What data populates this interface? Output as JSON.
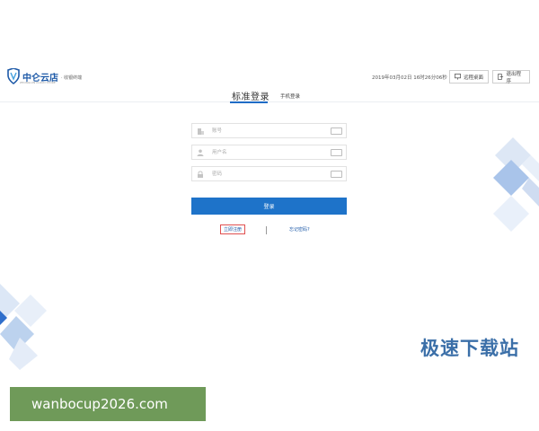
{
  "header": {
    "brand_name": "中仑云店",
    "brand_sub": "· 收银终端",
    "brand_en": "ZHONGLUN CLOUD STORE",
    "datetime": "2019年03月02日 16时26分06秒",
    "button_a": "远程桌面",
    "button_b": "退出程序"
  },
  "tabs": {
    "main": "标准登录",
    "sub": "手机登录"
  },
  "form": {
    "account_placeholder": "账号",
    "username_placeholder": "用户名",
    "password_placeholder": "密码",
    "login_label": "登录",
    "register_label": "立即注册",
    "forgot_label": "忘记密码?"
  },
  "watermark": {
    "text": "极速下载站",
    "url": "wanbocup2026.com"
  },
  "colors": {
    "primary": "#1e73c9",
    "brand": "#1e5aa8",
    "register_border": "#e05050",
    "banner": "#6f9a59",
    "decor_light": "#dbe6f5",
    "decor_mid": "#b9cfec",
    "decor_dark": "#4f86cf"
  }
}
